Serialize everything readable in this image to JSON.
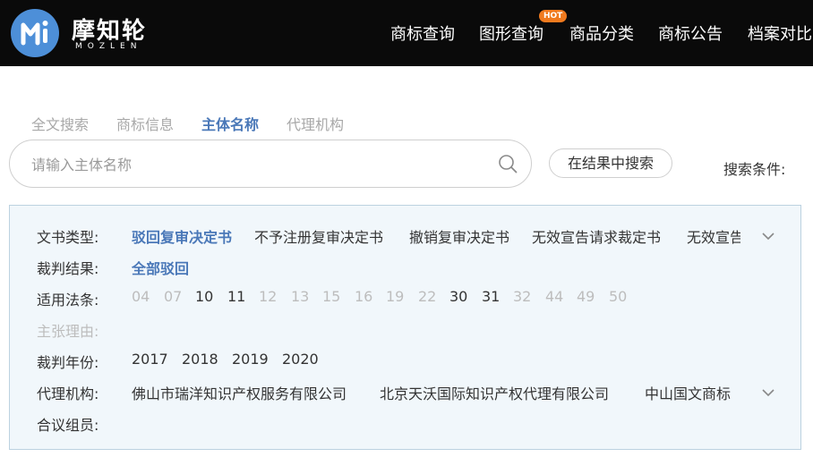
{
  "header": {
    "brand": "摩知轮",
    "brand_sub": "MOZLEN",
    "logo_letter": "M",
    "nav": [
      "商标查询",
      "图形查询",
      "商品分类",
      "商标公告",
      "档案对比"
    ],
    "hot_badge": "HOT"
  },
  "tabs": [
    "全文搜索",
    "商标信息",
    "主体名称",
    "代理机构"
  ],
  "active_tab": "主体名称",
  "search": {
    "placeholder": "请输入主体名称",
    "in_results_label": "在结果中搜索",
    "conditions_label": "搜索条件:"
  },
  "filters": {
    "doc_type": {
      "label": "文书类型:",
      "options": [
        "驳回复审决定书",
        "不予注册复审决定书",
        "撤销复审决定书",
        "无效宣告请求裁定书",
        "无效宣告"
      ],
      "selected": "驳回复审决定书"
    },
    "result": {
      "label": "裁判结果:",
      "options": [
        "全部驳回"
      ],
      "selected": "全部驳回"
    },
    "law": {
      "label": "适用法条:",
      "options": [
        "04",
        "07",
        "10",
        "11",
        "12",
        "13",
        "15",
        "16",
        "19",
        "22",
        "30",
        "31",
        "32",
        "44",
        "49",
        "50"
      ],
      "available": [
        "10",
        "11",
        "30",
        "31"
      ]
    },
    "claim": {
      "label": "主张理由:"
    },
    "year": {
      "label": "裁判年份:",
      "options": [
        "2017",
        "2018",
        "2019",
        "2020"
      ]
    },
    "agency": {
      "label": "代理机构:",
      "options": [
        "佛山市瑞洋知识产权服务有限公司",
        "北京天沃国际知识产权代理有限公司",
        "中山国文商标"
      ]
    },
    "panel_members": {
      "label": "合议组员:"
    }
  },
  "colors": {
    "header_bg": "#0a0a0a",
    "accent": "#4a78b8",
    "logo": "#4d8fd8",
    "hot": "#f07a1e",
    "panel_bg": "#f1f7fb",
    "panel_border": "#bcd2e0",
    "disabled": "#bdbdbd"
  },
  "icons": {
    "search": "search-icon",
    "expand": "chevron-down-icon"
  }
}
